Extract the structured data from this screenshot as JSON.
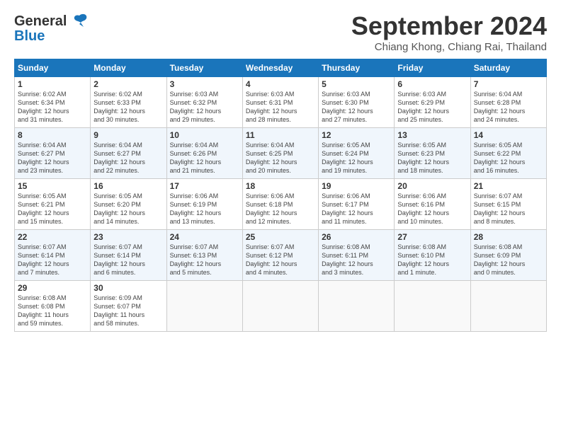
{
  "logo": {
    "line1": "General",
    "line2": "Blue"
  },
  "title": "September 2024",
  "location": "Chiang Khong, Chiang Rai, Thailand",
  "headers": [
    "Sunday",
    "Monday",
    "Tuesday",
    "Wednesday",
    "Thursday",
    "Friday",
    "Saturday"
  ],
  "weeks": [
    [
      {
        "day": "1",
        "detail": "Sunrise: 6:02 AM\nSunset: 6:34 PM\nDaylight: 12 hours\nand 31 minutes."
      },
      {
        "day": "2",
        "detail": "Sunrise: 6:02 AM\nSunset: 6:33 PM\nDaylight: 12 hours\nand 30 minutes."
      },
      {
        "day": "3",
        "detail": "Sunrise: 6:03 AM\nSunset: 6:32 PM\nDaylight: 12 hours\nand 29 minutes."
      },
      {
        "day": "4",
        "detail": "Sunrise: 6:03 AM\nSunset: 6:31 PM\nDaylight: 12 hours\nand 28 minutes."
      },
      {
        "day": "5",
        "detail": "Sunrise: 6:03 AM\nSunset: 6:30 PM\nDaylight: 12 hours\nand 27 minutes."
      },
      {
        "day": "6",
        "detail": "Sunrise: 6:03 AM\nSunset: 6:29 PM\nDaylight: 12 hours\nand 25 minutes."
      },
      {
        "day": "7",
        "detail": "Sunrise: 6:04 AM\nSunset: 6:28 PM\nDaylight: 12 hours\nand 24 minutes."
      }
    ],
    [
      {
        "day": "8",
        "detail": "Sunrise: 6:04 AM\nSunset: 6:27 PM\nDaylight: 12 hours\nand 23 minutes."
      },
      {
        "day": "9",
        "detail": "Sunrise: 6:04 AM\nSunset: 6:27 PM\nDaylight: 12 hours\nand 22 minutes."
      },
      {
        "day": "10",
        "detail": "Sunrise: 6:04 AM\nSunset: 6:26 PM\nDaylight: 12 hours\nand 21 minutes."
      },
      {
        "day": "11",
        "detail": "Sunrise: 6:04 AM\nSunset: 6:25 PM\nDaylight: 12 hours\nand 20 minutes."
      },
      {
        "day": "12",
        "detail": "Sunrise: 6:05 AM\nSunset: 6:24 PM\nDaylight: 12 hours\nand 19 minutes."
      },
      {
        "day": "13",
        "detail": "Sunrise: 6:05 AM\nSunset: 6:23 PM\nDaylight: 12 hours\nand 18 minutes."
      },
      {
        "day": "14",
        "detail": "Sunrise: 6:05 AM\nSunset: 6:22 PM\nDaylight: 12 hours\nand 16 minutes."
      }
    ],
    [
      {
        "day": "15",
        "detail": "Sunrise: 6:05 AM\nSunset: 6:21 PM\nDaylight: 12 hours\nand 15 minutes."
      },
      {
        "day": "16",
        "detail": "Sunrise: 6:05 AM\nSunset: 6:20 PM\nDaylight: 12 hours\nand 14 minutes."
      },
      {
        "day": "17",
        "detail": "Sunrise: 6:06 AM\nSunset: 6:19 PM\nDaylight: 12 hours\nand 13 minutes."
      },
      {
        "day": "18",
        "detail": "Sunrise: 6:06 AM\nSunset: 6:18 PM\nDaylight: 12 hours\nand 12 minutes."
      },
      {
        "day": "19",
        "detail": "Sunrise: 6:06 AM\nSunset: 6:17 PM\nDaylight: 12 hours\nand 11 minutes."
      },
      {
        "day": "20",
        "detail": "Sunrise: 6:06 AM\nSunset: 6:16 PM\nDaylight: 12 hours\nand 10 minutes."
      },
      {
        "day": "21",
        "detail": "Sunrise: 6:07 AM\nSunset: 6:15 PM\nDaylight: 12 hours\nand 8 minutes."
      }
    ],
    [
      {
        "day": "22",
        "detail": "Sunrise: 6:07 AM\nSunset: 6:14 PM\nDaylight: 12 hours\nand 7 minutes."
      },
      {
        "day": "23",
        "detail": "Sunrise: 6:07 AM\nSunset: 6:14 PM\nDaylight: 12 hours\nand 6 minutes."
      },
      {
        "day": "24",
        "detail": "Sunrise: 6:07 AM\nSunset: 6:13 PM\nDaylight: 12 hours\nand 5 minutes."
      },
      {
        "day": "25",
        "detail": "Sunrise: 6:07 AM\nSunset: 6:12 PM\nDaylight: 12 hours\nand 4 minutes."
      },
      {
        "day": "26",
        "detail": "Sunrise: 6:08 AM\nSunset: 6:11 PM\nDaylight: 12 hours\nand 3 minutes."
      },
      {
        "day": "27",
        "detail": "Sunrise: 6:08 AM\nSunset: 6:10 PM\nDaylight: 12 hours\nand 1 minute."
      },
      {
        "day": "28",
        "detail": "Sunrise: 6:08 AM\nSunset: 6:09 PM\nDaylight: 12 hours\nand 0 minutes."
      }
    ],
    [
      {
        "day": "29",
        "detail": "Sunrise: 6:08 AM\nSunset: 6:08 PM\nDaylight: 11 hours\nand 59 minutes."
      },
      {
        "day": "30",
        "detail": "Sunrise: 6:09 AM\nSunset: 6:07 PM\nDaylight: 11 hours\nand 58 minutes."
      },
      {
        "day": "",
        "detail": ""
      },
      {
        "day": "",
        "detail": ""
      },
      {
        "day": "",
        "detail": ""
      },
      {
        "day": "",
        "detail": ""
      },
      {
        "day": "",
        "detail": ""
      }
    ]
  ]
}
